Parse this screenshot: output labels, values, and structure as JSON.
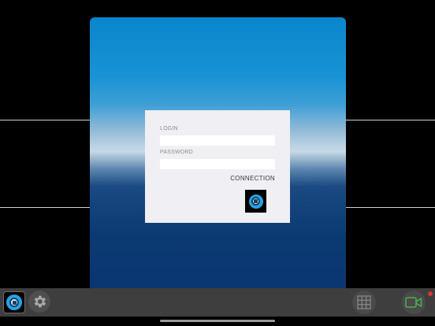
{
  "login_form": {
    "login_label": "LOGIN",
    "login_value": "",
    "password_label": "PASSWORD",
    "password_value": "",
    "connection_label": "CONNECTION"
  },
  "icons": {
    "app": "camera-lens-icon",
    "settings": "gear-icon",
    "grid": "grid-icon",
    "video": "video-camera-icon",
    "card_logo": "camera-lens-icon"
  },
  "colors": {
    "accent_blue": "#1792d4",
    "deep_blue": "#0a3470",
    "video_green": "#4caf50",
    "record_red": "#d33333"
  }
}
